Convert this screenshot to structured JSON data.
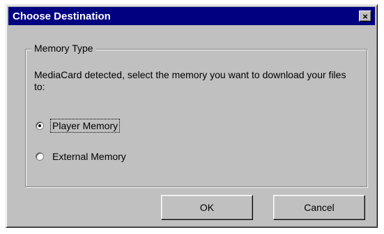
{
  "window": {
    "title": "Choose Destination",
    "close_glyph": "×",
    "title_bar_color": "#000080",
    "face_color": "#c0c0c0"
  },
  "memory_group": {
    "legend": "Memory Type",
    "description": "MediaCard detected, select the memory you want to download your files to:",
    "options": [
      {
        "label": "Player Memory",
        "selected": true
      },
      {
        "label": "External Memory",
        "selected": false
      }
    ]
  },
  "buttons": {
    "ok_label": "OK",
    "cancel_label": "Cancel"
  }
}
